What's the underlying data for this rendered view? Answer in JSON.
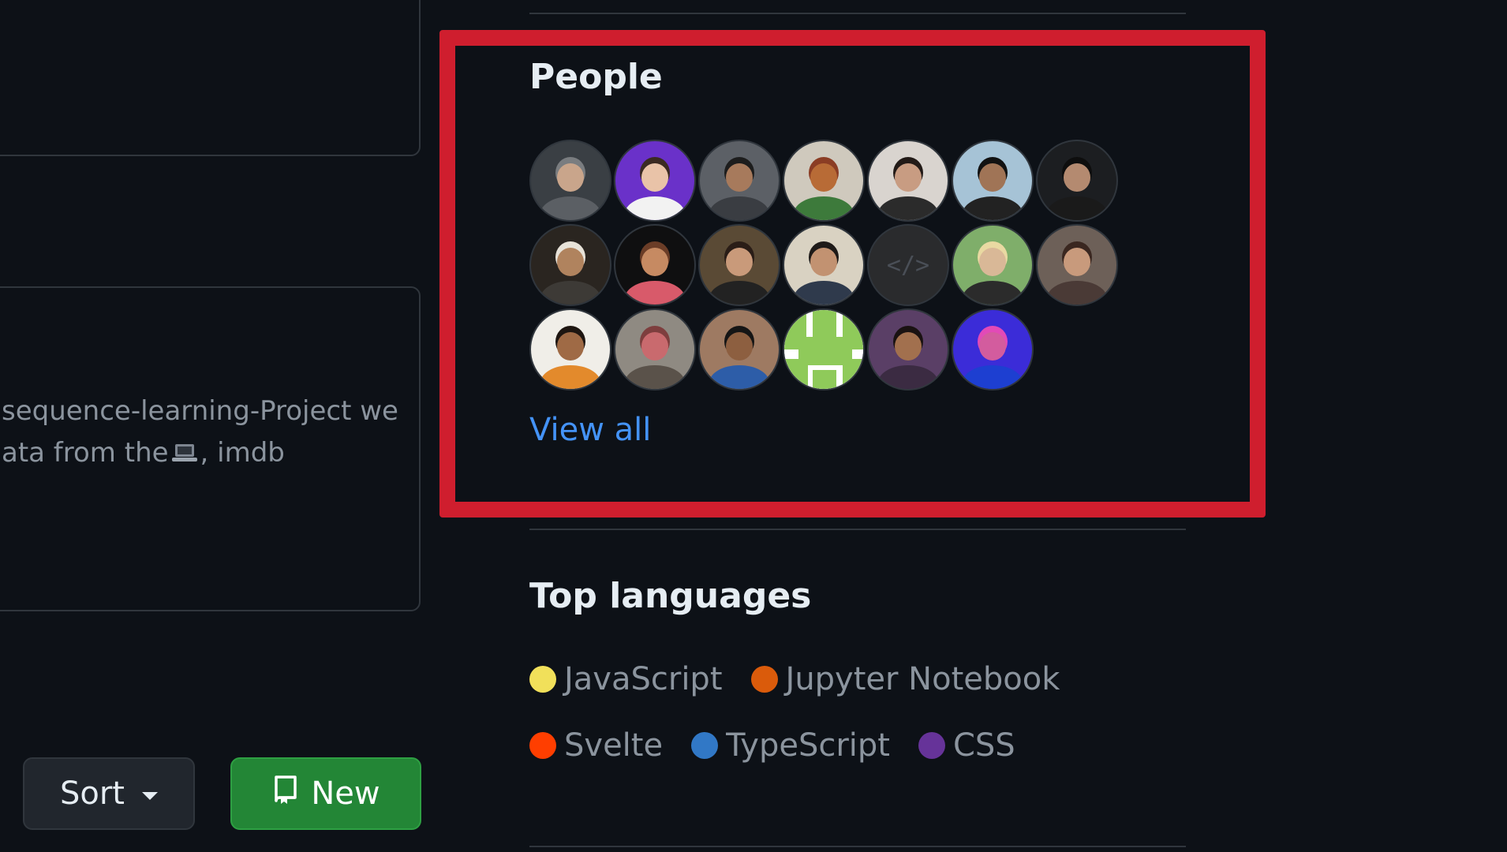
{
  "repo": {
    "description_line1": "sequence-learning-Project we",
    "description_line2_pre": "ata from the",
    "description_line2_post": ", imdb"
  },
  "toolbar": {
    "sort_label": "Sort",
    "new_label": "New"
  },
  "people": {
    "title": "People",
    "view_all": "View all",
    "avatars": [
      {
        "bg": "#3a3f44",
        "skin": "#c9a58b",
        "shirt": "#5b5f64",
        "hair": "#7a7d80"
      },
      {
        "bg": "#6a31c9",
        "skin": "#e9c3a8",
        "shirt": "#f2f2f2",
        "hair": "#3b2a22"
      },
      {
        "bg": "#5c6066",
        "skin": "#a77a5c",
        "shirt": "#3a3d42",
        "hair": "#1d1d1d"
      },
      {
        "bg": "#cfc9bd",
        "skin": "#b86b36",
        "shirt": "#3d7a3b",
        "hair": "#8b3d24"
      },
      {
        "bg": "#d9d4cf",
        "skin": "#c89c82",
        "shirt": "#2b2b2b",
        "hair": "#221a17"
      },
      {
        "bg": "#a6c3d6",
        "skin": "#a07456",
        "shirt": "#222222",
        "hair": "#121212"
      },
      {
        "bg": "#1c1e21",
        "skin": "#b48a70",
        "shirt": "#1a1a1a",
        "hair": "#0e0e0e"
      },
      {
        "bg": "#2a2520",
        "skin": "#b0835e",
        "shirt": "#3d3a36",
        "hair": "#e7e2d8"
      },
      {
        "bg": "#0f0f10",
        "skin": "#c68a62",
        "shirt": "#d85a6a",
        "hair": "#6b3d27"
      },
      {
        "bg": "#5a4a35",
        "skin": "#c99a7a",
        "shirt": "#222222",
        "hair": "#2a1d17"
      },
      {
        "bg": "#d9d2c2",
        "skin": "#c29271",
        "shirt": "#2f3a4c",
        "hair": "#1e1a18"
      },
      {
        "bg": "#2a2b2d",
        "glyph": "</>"
      },
      {
        "bg": "#7fae6a",
        "skin": "#d9b897",
        "shirt": "#2b2b2b",
        "hair": "#e9d9a2"
      },
      {
        "bg": "#6d6058",
        "skin": "#c89a7c",
        "shirt": "#4a3a36",
        "hair": "#3a2720"
      },
      {
        "bg": "#f0eee8",
        "skin": "#9f6a45",
        "shirt": "#e38a2c",
        "hair": "#1e1611"
      },
      {
        "bg": "#8f8a82",
        "skin": "#c96a6e",
        "shirt": "#5a524a",
        "hair": "#7e3e3e"
      },
      {
        "bg": "#9e7a62",
        "skin": "#8d5f40",
        "shirt": "#2d5da8",
        "hair": "#151515"
      },
      {
        "bg": "#ffffff",
        "identicon": true
      },
      {
        "bg": "#5a3f66",
        "skin": "#a2704e",
        "shirt": "#3b2b42",
        "hair": "#1a1212"
      },
      {
        "bg": "#3b2cd8",
        "skin": "#d35c9e",
        "shirt": "#1d3fd1",
        "hair": "#e24ab7"
      }
    ]
  },
  "languages": {
    "title": "Top languages",
    "items": [
      {
        "name": "JavaScript",
        "color": "#f1e05a"
      },
      {
        "name": "Jupyter Notebook",
        "color": "#DA5B0B"
      },
      {
        "name": "Svelte",
        "color": "#ff3e00"
      },
      {
        "name": "TypeScript",
        "color": "#3178c6"
      },
      {
        "name": "CSS",
        "color": "#663399"
      }
    ]
  },
  "theme": {
    "highlight": "#cf1e2e",
    "link": "#4493f8",
    "primary_button": "#238636"
  }
}
